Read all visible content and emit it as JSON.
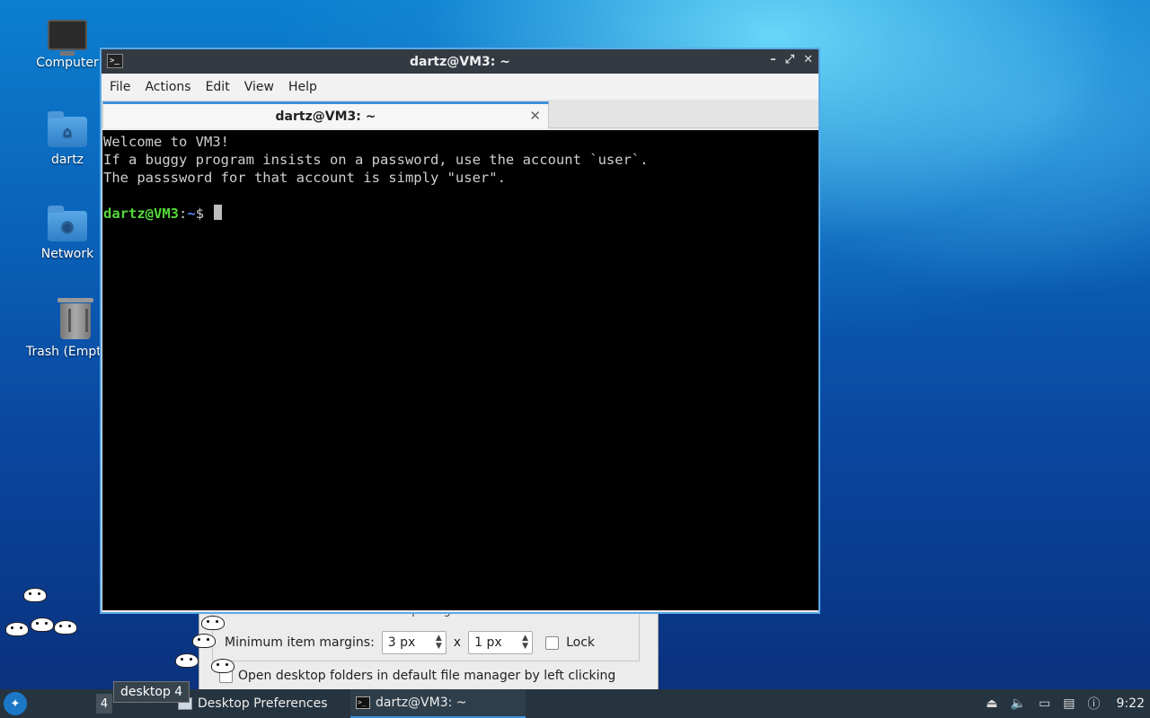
{
  "desktop": {
    "icons": [
      {
        "label": "Computer",
        "icon": "computer-icon"
      },
      {
        "label": "dartz",
        "icon": "home-folder-icon",
        "symbol": "⌂"
      },
      {
        "label": "Network",
        "icon": "network-folder-icon",
        "symbol": "◉"
      },
      {
        "label": "Trash (Empt",
        "icon": "trash-icon"
      }
    ]
  },
  "pref_dialog": {
    "spacing_label": "Spacing",
    "margins_label": "Minimum item margins:",
    "margin_x_value": "3 px",
    "times": "x",
    "margin_y_value": "1 px",
    "lock_label": "Lock",
    "open_folders_label": "Open desktop folders in default file manager by left clicking"
  },
  "terminal": {
    "window_title": "dartz@VM3: ~",
    "menu": [
      "File",
      "Actions",
      "Edit",
      "View",
      "Help"
    ],
    "tab_title": "dartz@VM3: ~",
    "lines": [
      "Welcome to VM3!",
      "If a buggy program insists on a password, use the account `user`.",
      "The passsword for that account is simply \"user\"."
    ],
    "prompt_user": "dartz@VM3",
    "prompt_sep": ":",
    "prompt_path": "~",
    "prompt_symbol": "$"
  },
  "taskbar": {
    "desktop_number": "4",
    "desktop_tooltip": "desktop 4",
    "tasks": [
      {
        "label": "Desktop Preferences",
        "active": false
      },
      {
        "label": "dartz@VM3: ~",
        "active": true
      }
    ],
    "clock": "9:22"
  },
  "colors": {
    "accent": "#3d8fd9",
    "prompt_user": "#55d93b",
    "prompt_path": "#5a8fff",
    "titlebar": "#333a42",
    "taskbar": "#26343f"
  }
}
